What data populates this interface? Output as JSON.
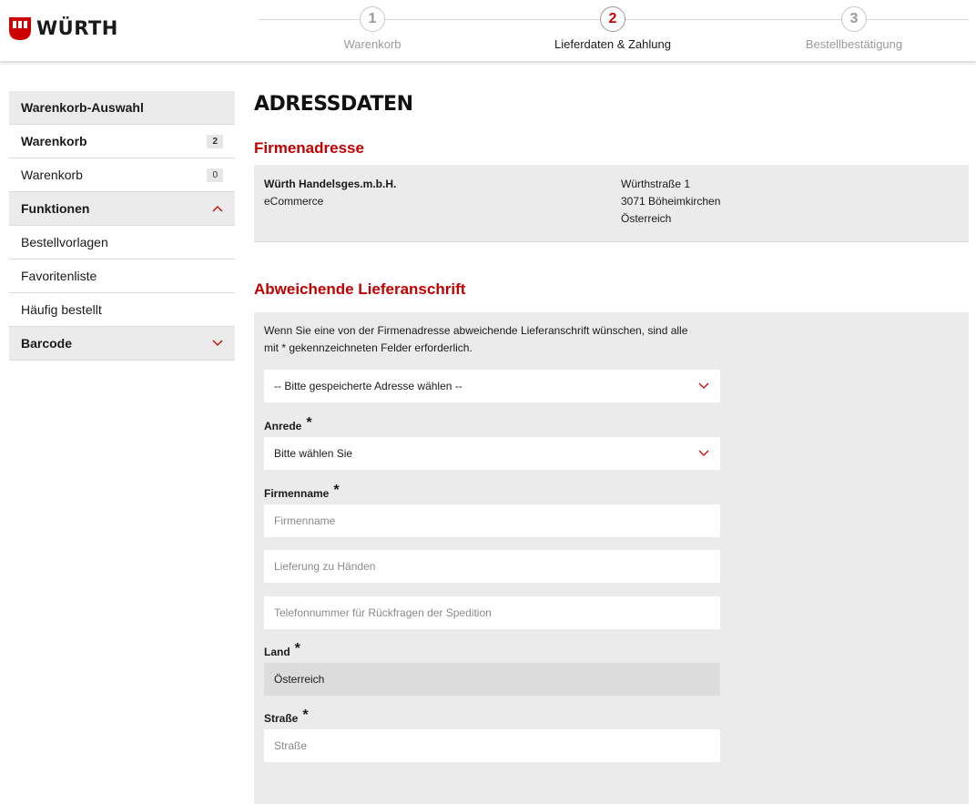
{
  "brand": {
    "logo_text": "WÜRTH",
    "accent": "#cc0000"
  },
  "steps": [
    {
      "num": "1",
      "label": "Warenkorb"
    },
    {
      "num": "2",
      "label": "Lieferdaten & Zahlung"
    },
    {
      "num": "3",
      "label": "Bestellbestätigung"
    }
  ],
  "sidebar": {
    "cart_header": "Warenkorb-Auswahl",
    "carts": [
      {
        "label": "Warenkorb",
        "count": "2"
      },
      {
        "label": "Warenkorb",
        "count": "0"
      }
    ],
    "functions_header": "Funktionen",
    "functions": [
      "Bestellvorlagen",
      "Favoritenliste",
      "Häufig bestellt"
    ],
    "barcode_header": "Barcode"
  },
  "main": {
    "page_title": "ADRESSDATEN",
    "company_section": {
      "title": "Firmenadresse",
      "company_name": "Würth Handelsges.m.b.H.",
      "company_sub": "eCommerce",
      "street": "Würthstraße 1",
      "city": "3071 Böheimkirchen",
      "country": "Österreich"
    },
    "delivery_section": {
      "title": "Abweichende Lieferanschrift",
      "intro_line1": "Wenn Sie eine von der Firmenadresse abweichende Lieferanschrift wünschen, sind alle",
      "intro_line2": "mit * gekennzeichneten Felder erforderlich.",
      "saved_address_select": "-- Bitte gespeicherte Adresse wählen --",
      "anrede_label": "Anrede",
      "anrede_value": "Bitte wählen Sie",
      "firmenname_label": "Firmenname",
      "firmenname_placeholder": "Firmenname",
      "attention_placeholder": "Lieferung zu Händen",
      "phone_placeholder": "Telefonnummer für Rückfragen der Spedition",
      "land_label": "Land",
      "land_value": "Österreich",
      "strasse_label": "Straße",
      "strasse_placeholder": "Straße",
      "required_marker": "*"
    }
  }
}
